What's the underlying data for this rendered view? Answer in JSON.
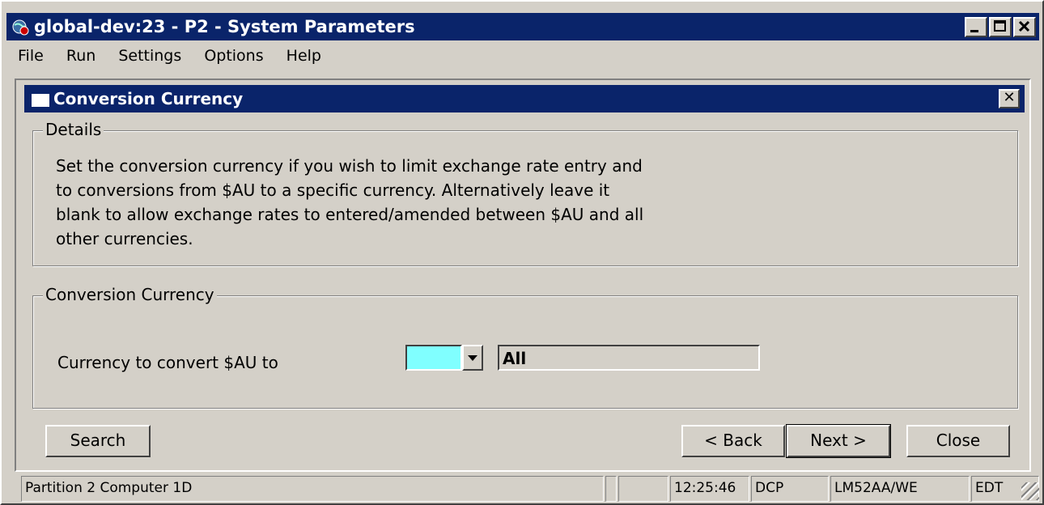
{
  "window": {
    "title": "global-dev:23 - P2 - System Parameters",
    "icon": "app-globe-icon"
  },
  "menubar": {
    "items": [
      "File",
      "Run",
      "Settings",
      "Options",
      "Help"
    ]
  },
  "dialog": {
    "title": "Conversion Currency",
    "details": {
      "legend": "Details",
      "lines": [
        "Set the conversion currency if you wish to limit exchange rate entry and",
        "to conversions from $AU to a specific currency.   Alternatively leave it",
        "blank to allow exchange rates to entered/amended between $AU and all",
        "other currencies."
      ]
    },
    "conversion": {
      "legend": "Conversion Currency",
      "field_label": "Currency to convert $AU to",
      "currency_value": "",
      "description": "All"
    },
    "buttons": {
      "search": "Search",
      "back": "< Back",
      "next": "Next >",
      "close": "Close"
    }
  },
  "statusbar": {
    "message": "Partition 2 Computer 1D",
    "time": "12:25:46",
    "mode": "DCP",
    "terminal": "LM52AA/WE",
    "edit": "EDT"
  },
  "colors": {
    "titlebar": "#0a246a",
    "face": "#d4d0c8",
    "input_highlight": "#80ffff"
  }
}
